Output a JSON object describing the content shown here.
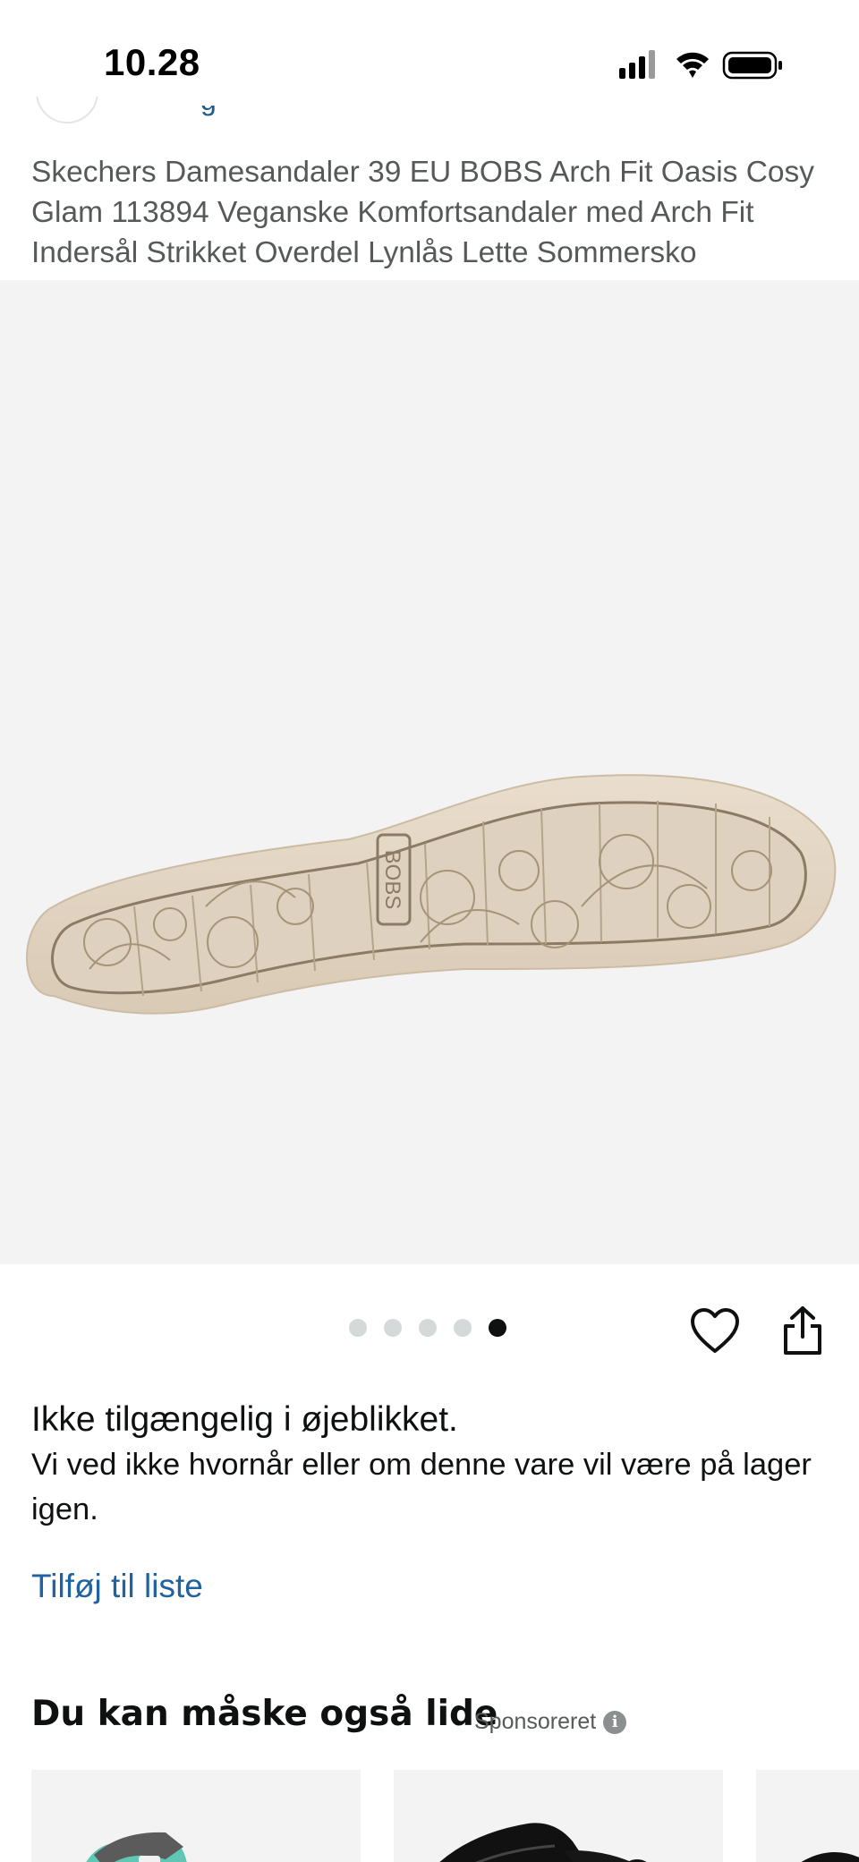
{
  "status_bar": {
    "time": "10.28"
  },
  "product": {
    "title": "Skechers Damesandaler 39 EU BOBS Arch Fit Oasis Cosy Glam 113894 Veganske Komfortsandaler med Arch Fit Indersål Strikket Overdel Lynlås Lette Sommersko",
    "image_logo_text": "BOBS",
    "image_count": 5,
    "active_image_index": 4
  },
  "availability": {
    "title": "Ikke tilgængelig i øjeblikket.",
    "description": "Vi ved ikke hvornår eller om denne vare vil være på lager igen."
  },
  "actions": {
    "add_to_list": "Tilføj til liste"
  },
  "recommendations": {
    "title": "Du kan måske også lide",
    "sponsored_label": "Sponsoreret"
  },
  "icons": [
    "signal-icon",
    "wifi-icon",
    "battery-icon",
    "heart-icon",
    "share-icon",
    "info-icon"
  ],
  "colors": {
    "link": "#2162a1",
    "text": "#0f1111",
    "muted": "#565959",
    "gallery_bg": "#f3f3f3"
  }
}
